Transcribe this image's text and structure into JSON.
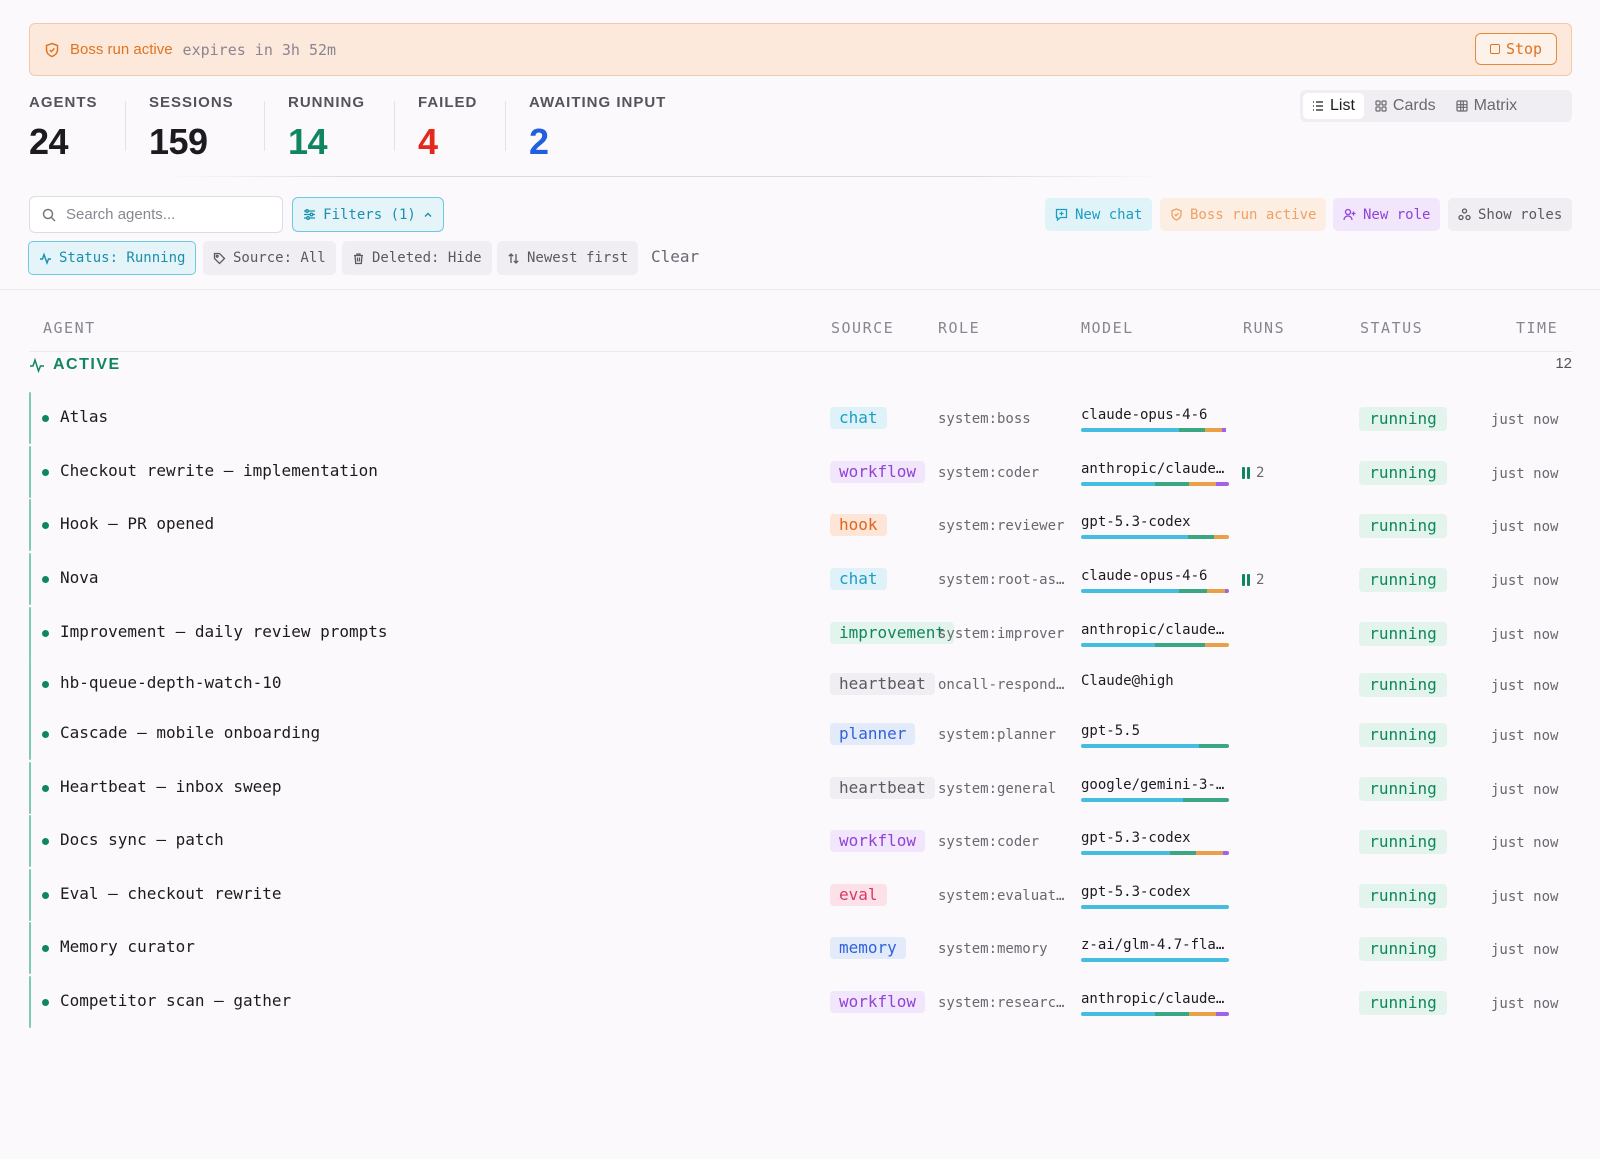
{
  "banner": {
    "title": "Boss run active",
    "expires": "expires in 3h 52m",
    "stop_label": "Stop",
    "color": "#e0731f"
  },
  "stats": [
    {
      "label": "AGENTS",
      "value": "24",
      "color": "#1c1b1f"
    },
    {
      "label": "SESSIONS",
      "value": "159",
      "color": "#1c1b1f"
    },
    {
      "label": "RUNNING",
      "value": "14",
      "color": "#10865f"
    },
    {
      "label": "FAILED",
      "value": "4",
      "color": "#e5281e"
    },
    {
      "label": "AWAITING INPUT",
      "value": "2",
      "color": "#1f5fe0"
    }
  ],
  "views": [
    {
      "label": "List",
      "icon": "list-icon",
      "active": true
    },
    {
      "label": "Cards",
      "icon": "cards-icon",
      "active": false
    },
    {
      "label": "Matrix",
      "icon": "matrix-icon",
      "active": false
    }
  ],
  "search": {
    "placeholder": "Search agents..."
  },
  "filters_button": "Filters (1)",
  "actions": {
    "new_chat": "New chat",
    "boss_run": "Boss run active",
    "new_role": "New role",
    "show_roles": "Show roles"
  },
  "chips": {
    "status": "Status: Running",
    "source": "Source: All",
    "deleted": "Deleted: Hide",
    "sort": "Newest first",
    "clear": "Clear"
  },
  "table": {
    "headers": {
      "agent": "AGENT",
      "source": "SOURCE",
      "role": "ROLE",
      "model": "MODEL",
      "runs": "RUNS",
      "status": "STATUS",
      "time": "TIME"
    },
    "group": {
      "title": "ACTIVE",
      "count": "12"
    },
    "rows": [
      {
        "name": "Atlas",
        "source": "chat",
        "role": "system:boss",
        "model": "claude-opus-4-6",
        "runs": "",
        "status": "running",
        "time": "just now",
        "bar": [
          0.66,
          0.18,
          0.11,
          0.03
        ]
      },
      {
        "name": "Checkout rewrite — implementation",
        "source": "workflow",
        "role": "system:coder",
        "model": "anthropic/claude…",
        "runs": "2",
        "status": "running",
        "time": "just now",
        "bar": [
          0.5,
          0.23,
          0.18,
          0.09
        ]
      },
      {
        "name": "Hook — PR opened",
        "source": "hook",
        "role": "system:reviewer",
        "model": "gpt-5.3-codex",
        "runs": "",
        "status": "running",
        "time": "just now",
        "bar": [
          0.72,
          0.18,
          0.1,
          0
        ]
      },
      {
        "name": "Nova",
        "source": "chat",
        "role": "system:root-as…",
        "model": "claude-opus-4-6",
        "runs": "2",
        "status": "running",
        "time": "just now",
        "bar": [
          0.66,
          0.19,
          0.12,
          0.03
        ]
      },
      {
        "name": "Improvement — daily review prompts",
        "source": "improvement",
        "role": "system:improver",
        "model": "anthropic/claude…",
        "runs": "",
        "status": "running",
        "time": "just now",
        "bar": [
          0.5,
          0.34,
          0.16,
          0
        ]
      },
      {
        "name": "hb-queue-depth-watch-10",
        "source": "heartbeat",
        "role": "oncall-respond…",
        "model": "Claude@high",
        "runs": "",
        "status": "running",
        "time": "just now",
        "bar": null
      },
      {
        "name": "Cascade — mobile onboarding",
        "source": "planner",
        "role": "system:planner",
        "model": "gpt-5.5",
        "runs": "",
        "status": "running",
        "time": "just now",
        "bar": [
          0.8,
          0.2,
          0,
          0
        ]
      },
      {
        "name": "Heartbeat — inbox sweep",
        "source": "heartbeat",
        "role": "system:general",
        "model": "google/gemini-3-…",
        "runs": "",
        "status": "running",
        "time": "just now",
        "bar": [
          0.69,
          0.31,
          0,
          0
        ]
      },
      {
        "name": "Docs sync — patch",
        "source": "workflow",
        "role": "system:coder",
        "model": "gpt-5.3-codex",
        "runs": "",
        "status": "running",
        "time": "just now",
        "bar": [
          0.6,
          0.18,
          0.18,
          0.04
        ]
      },
      {
        "name": "Eval — checkout rewrite",
        "source": "eval",
        "role": "system:evaluat…",
        "model": "gpt-5.3-codex",
        "runs": "",
        "status": "running",
        "time": "just now",
        "bar": [
          1,
          0,
          0,
          0
        ]
      },
      {
        "name": "Memory curator",
        "source": "memory",
        "role": "system:memory",
        "model": "z-ai/glm-4.7-fla…",
        "runs": "",
        "status": "running",
        "time": "just now",
        "bar": [
          1,
          0,
          0,
          0
        ]
      },
      {
        "name": "Competitor scan — gather",
        "source": "workflow",
        "role": "system:researc…",
        "model": "anthropic/claude…",
        "runs": "",
        "status": "running",
        "time": "just now",
        "bar": [
          0.5,
          0.23,
          0.18,
          0.09
        ]
      }
    ]
  },
  "bar_colors": [
    "#45bde0",
    "#3aa682",
    "#e9a048",
    "#9e63e6"
  ]
}
